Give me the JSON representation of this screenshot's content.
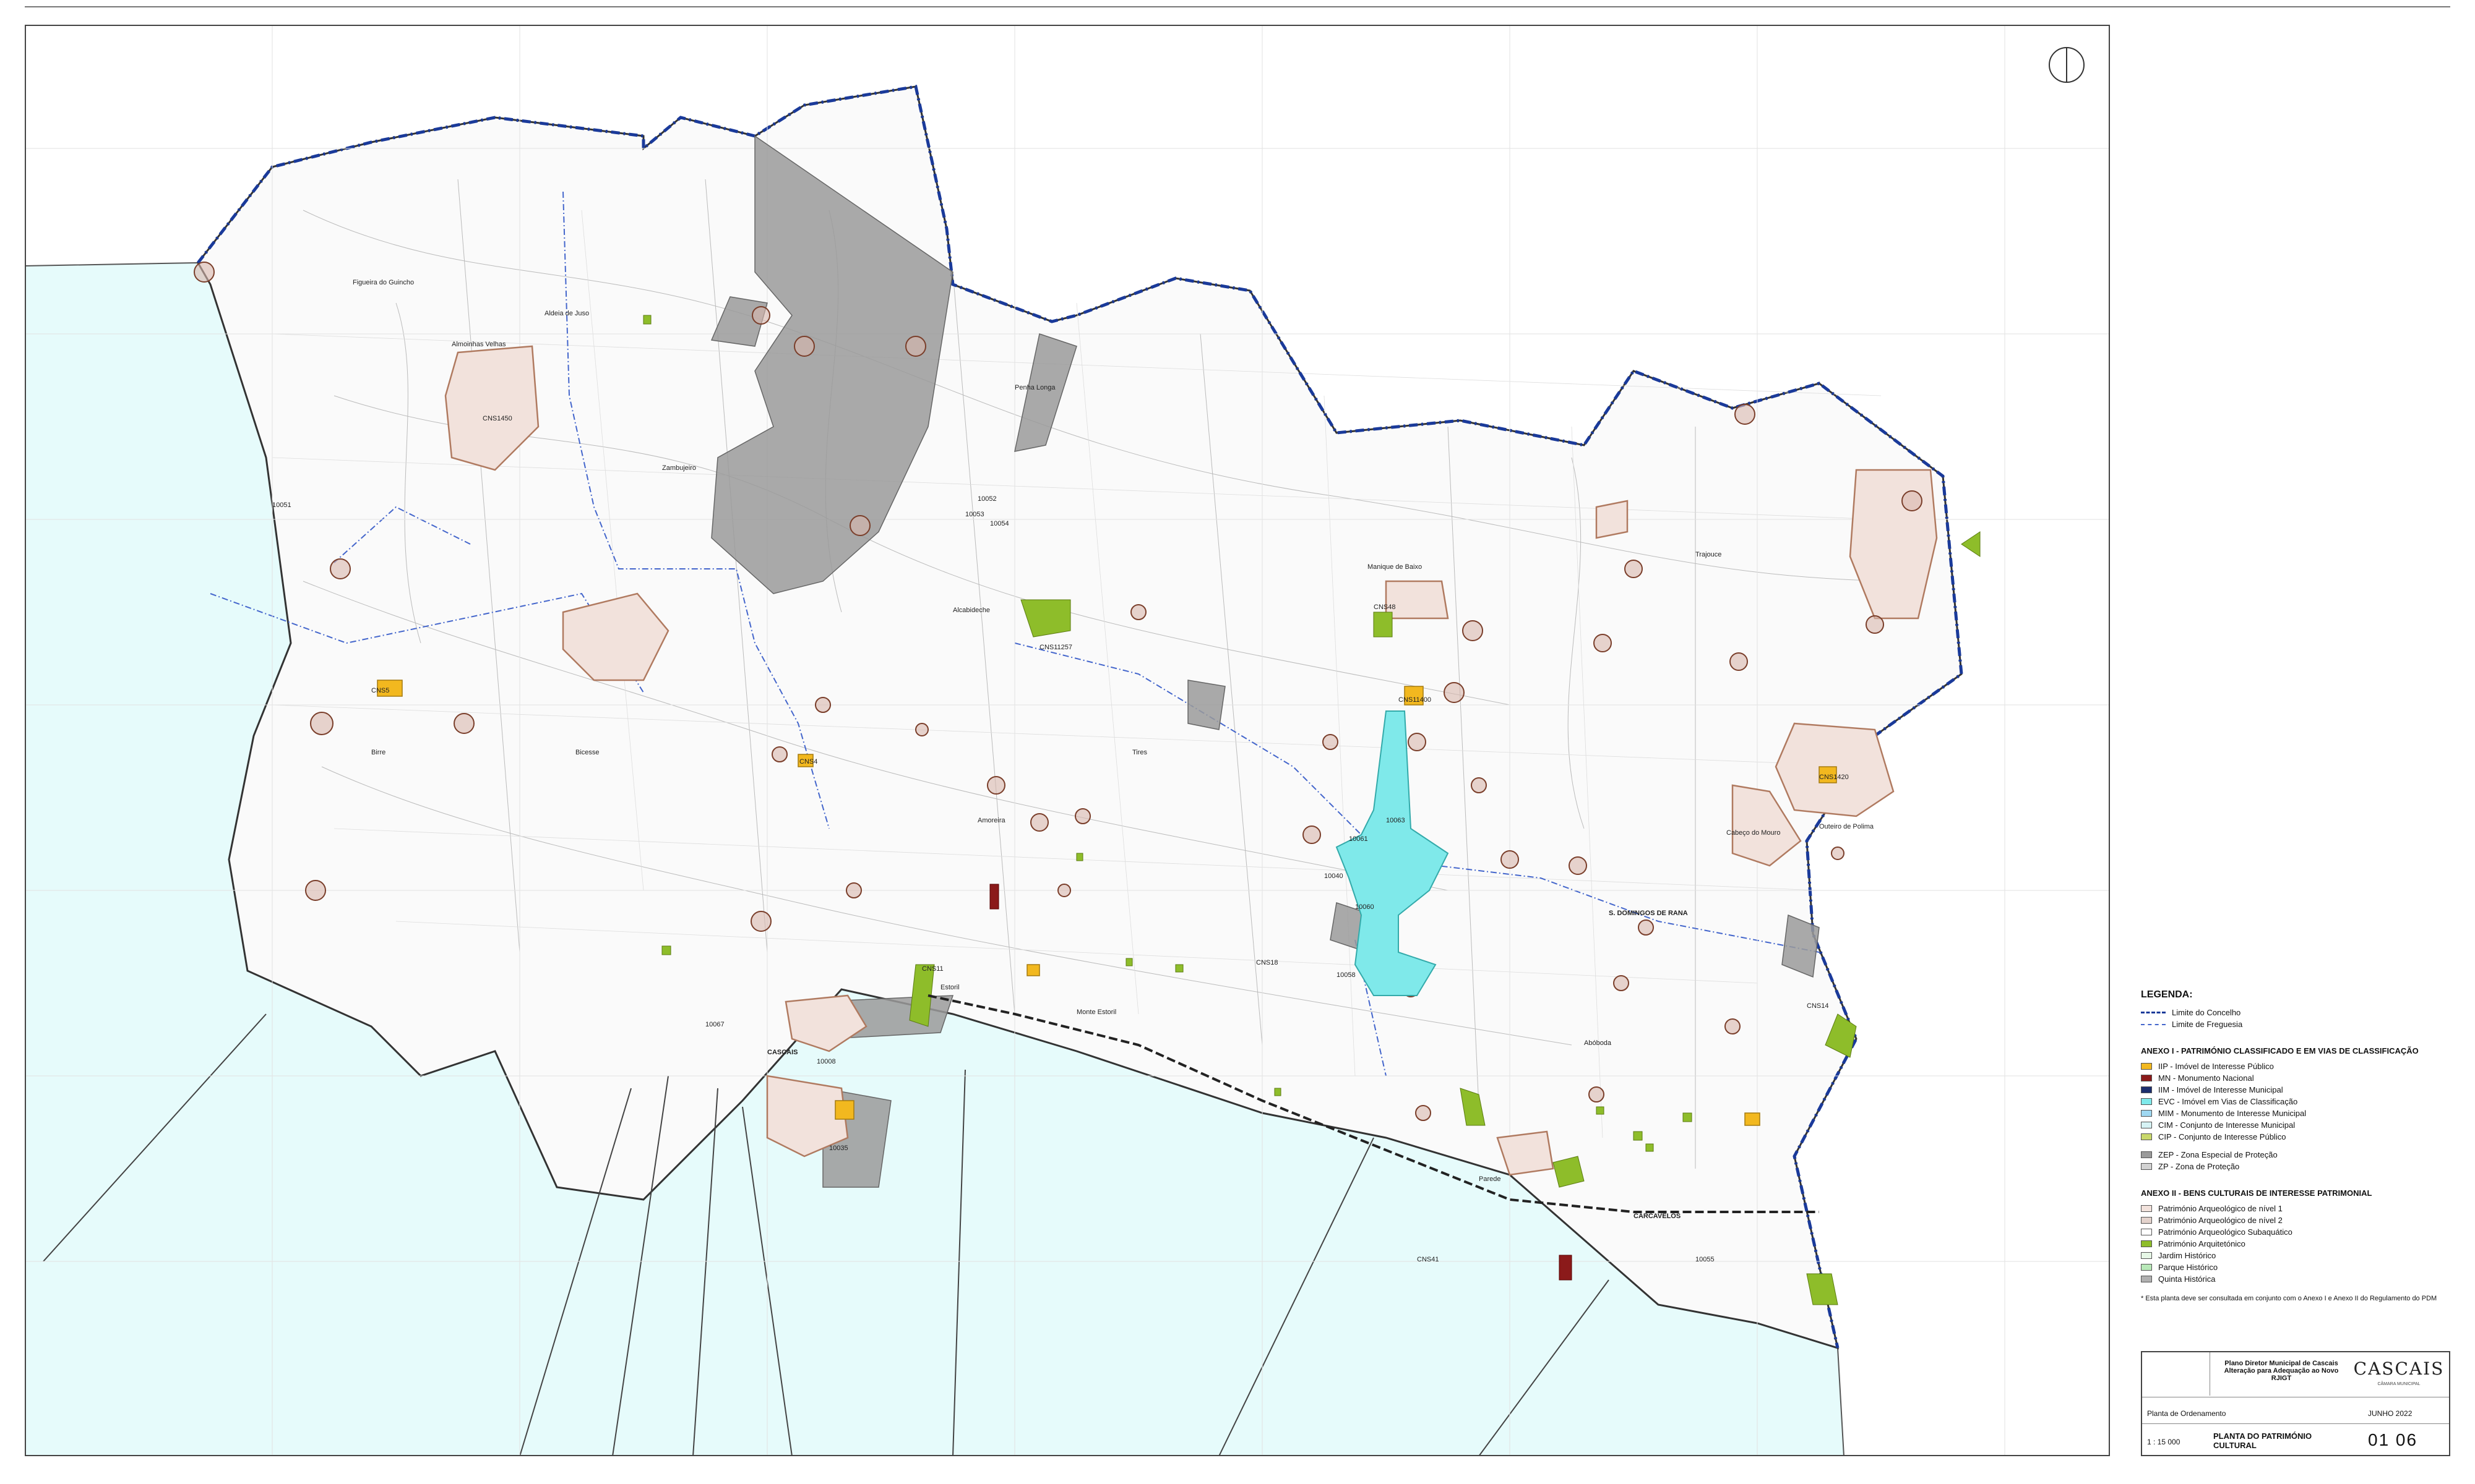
{
  "map": {
    "place_labels": [
      "CNS1450",
      "CNS5",
      "CNS11257",
      "CNS11400",
      "CNS4",
      "CNS1420",
      "CNS48",
      "CNS41",
      "CNS18",
      "CNS11",
      "CNS14",
      "10051",
      "10052",
      "10053",
      "10054",
      "10063",
      "10061",
      "10060",
      "10058",
      "10067",
      "10040",
      "10008",
      "10035",
      "10055",
      "CASCAIS",
      "CARCAVELOS",
      "S. DOMINGOS DE RANA",
      "Alcabideche",
      "Almoinhas Velhas",
      "Aldeia de Juso",
      "Figueira do Guincho",
      "Birre",
      "Bicesse",
      "Tires",
      "Zambujeiro",
      "Penha Longa",
      "Amoreira",
      "Manique de Baixo",
      "Trajouce",
      "Outeiro de Polima",
      "Cabeço do Mouro",
      "Abóboda",
      "Parede",
      "Estoril",
      "Monte Estoril"
    ]
  },
  "legend": {
    "title": "LEGENDA:",
    "limits": [
      {
        "label": "Limite do Concelho",
        "style": "dashed",
        "color": "#1a3a9a"
      },
      {
        "label": "Limite de Freguesia",
        "style": "dashdot",
        "color": "#4466cc"
      }
    ],
    "anexo1_title": "ANEXO I - PATRIMÓNIO CLASSIFICADO E EM VIAS DE CLASSIFICAÇÃO",
    "anexo1": [
      {
        "label": "IIP - Imóvel de Interesse Público",
        "color": "#f2b81f"
      },
      {
        "label": "MN - Monumento Nacional",
        "color": "#8b1a1a"
      },
      {
        "label": "IIM - Imóvel de Interesse Municipal",
        "color": "#1c2e6e"
      },
      {
        "label": "EVC - Imóvel em Vias de Classificação",
        "color": "#7fe9ea"
      },
      {
        "label": "MIM - Monumento de Interesse Municipal",
        "color": "#9fd8f2"
      },
      {
        "label": "CIM - Conjunto de Interesse Municipal",
        "color": "#d6f2f4"
      },
      {
        "label": "CIP - Conjunto de Interesse Público",
        "color": "#c9d86b"
      }
    ],
    "zonas": [
      {
        "label": "ZEP - Zona Especial de Proteção",
        "color": "#9a9a9a"
      },
      {
        "label": "ZP - Zona de Proteção",
        "color": "#d2d2d2"
      }
    ],
    "anexo2_title": "ANEXO II - BENS CULTURAIS DE INTERESSE PATRIMONIAL",
    "anexo2": [
      {
        "label": "Património Arqueológico de nível 1",
        "color": "#f2e2dc"
      },
      {
        "label": "Património Arqueológico de nível 2",
        "color": "#e3d2cc"
      },
      {
        "label": "Património Arqueológico Subaquático",
        "color": "#ffffff"
      },
      {
        "label": "Património Arquitetónico",
        "color": "#8ebd2a"
      },
      {
        "label": "Jardim Histórico",
        "color": "#e6f7e6"
      },
      {
        "label": "Parque Histórico",
        "color": "#b8e8b8"
      },
      {
        "label": "Quinta Histórica",
        "color": "#b0b0b0"
      }
    ],
    "note": "* Esta planta deve ser consultada em conjunto com o Anexo I e Anexo II do Regulamento do PDM"
  },
  "title_block": {
    "plan_line1": "Plano Diretor Municipal de Cascais",
    "plan_line2": "Alteração para Adequação ao Novo RJIGT",
    "logo": "CASCAIS",
    "logo_sub": "CÂMARA MUNICIPAL",
    "subject": "Planta de Ordenamento",
    "date": "JUNHO 2022",
    "scale": "1 : 15 000",
    "sheet_title_line1": "PLANTA DO PATRIMÓNIO",
    "sheet_title_line2": "CULTURAL",
    "sheet_number": "01 06"
  },
  "colors": {
    "sea": "#e6fbfb",
    "land": "#ffffff",
    "boundary": "#1a3a9a",
    "zep": "#9a9a9a",
    "arch1": "#f2e2dc",
    "arch_stroke": "#b07a60",
    "iip": "#f2b81f",
    "mn": "#8b1a1a",
    "evc": "#7fe9ea",
    "arquitetonico": "#8ebd2a"
  }
}
